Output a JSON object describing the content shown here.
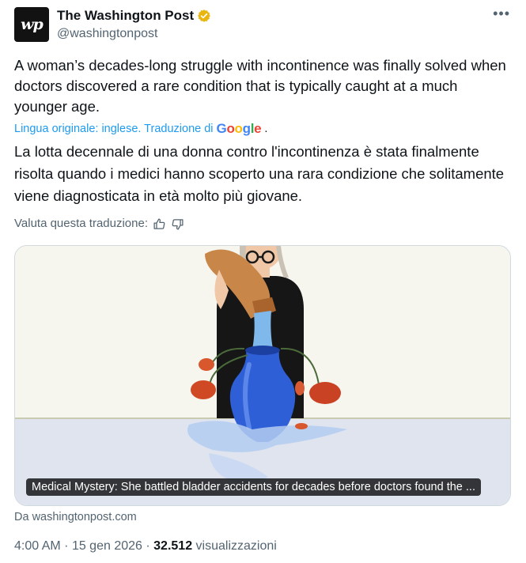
{
  "author": {
    "avatar_text": "wp",
    "name": "The Washington Post",
    "handle": "@washingtonpost"
  },
  "tweet": {
    "text": "A woman’s decades-long struggle with incontinence was finally solved when doctors discovered a rare condition that is typically caught at a much younger age.",
    "translation_note": "Lingua originale: inglese. Traduzione di",
    "translation_suffix": ".",
    "translated_text": "La lotta decennale di una donna contro l'incontinenza è stata finalmente risolta quando i medici hanno scoperto una rara condizione che solitamente viene diagnosticata in età molto più giovane.",
    "rate_label": "Valuta questa traduzione:"
  },
  "card": {
    "caption": "Medical Mystery: She battled bladder accidents for decades before doctors found the ...",
    "source": "Da washingtonpost.com"
  },
  "meta": {
    "time": "4:00 AM",
    "date": "15 gen 2026",
    "views": "32.512",
    "views_label": "visualizzazioni"
  },
  "icons": [
    "verified-badge-icon",
    "more-options-icon",
    "thumbs-up-icon",
    "thumbs-down-icon"
  ],
  "colors": {
    "link": "#1d9bf0",
    "verified": "#e8b511",
    "muted": "#536471"
  }
}
